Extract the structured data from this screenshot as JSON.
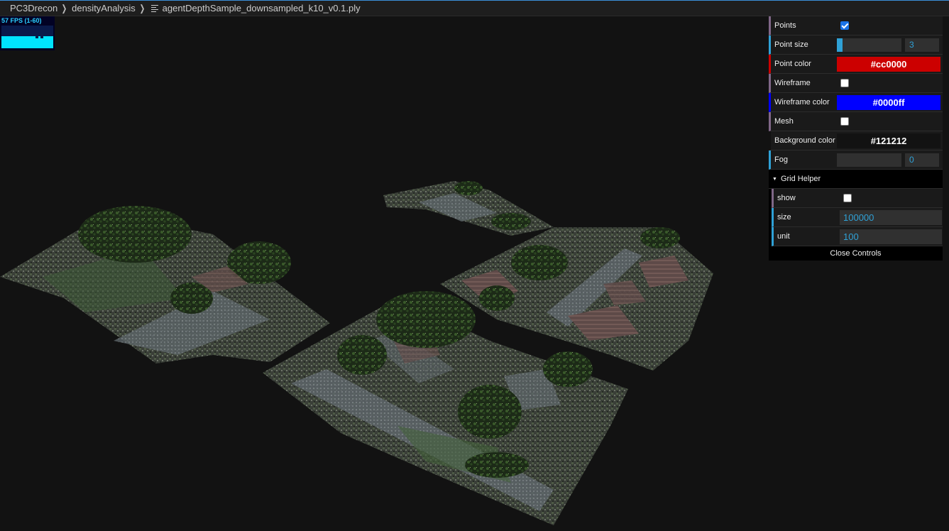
{
  "breadcrumb": {
    "items": [
      "PC3Drecon",
      "densityAnalysis"
    ],
    "file": "agentDepthSample_downsampled_k10_v0.1.ply",
    "separator_icon": "chevron-right-icon",
    "file_icon": "file-lines-icon"
  },
  "stats": {
    "label": "57 FPS (1-60)",
    "fps": 57,
    "min": 1,
    "max": 60
  },
  "scene": {
    "description_icon": "point-cloud-render",
    "background_color": "#121212"
  },
  "controls": {
    "points": {
      "label": "Points",
      "checked": true
    },
    "point_size": {
      "label": "Point size",
      "value": "3",
      "slider_fraction": 0.06
    },
    "point_color": {
      "label": "Point color",
      "value": "#cc0000"
    },
    "wireframe": {
      "label": "Wireframe",
      "checked": false
    },
    "wireframe_color": {
      "label": "Wireframe color",
      "value": "#0000ff"
    },
    "mesh": {
      "label": "Mesh",
      "checked": false
    },
    "background_color": {
      "label": "Background color",
      "value": "#121212"
    },
    "fog": {
      "label": "Fog",
      "value": "0",
      "slider_fraction": 0
    },
    "grid_helper": {
      "title": "Grid Helper",
      "show": {
        "label": "show",
        "checked": false
      },
      "size": {
        "label": "size",
        "value": "100000"
      },
      "unit": {
        "label": "unit",
        "value": "100"
      }
    },
    "close_label": "Close Controls"
  }
}
